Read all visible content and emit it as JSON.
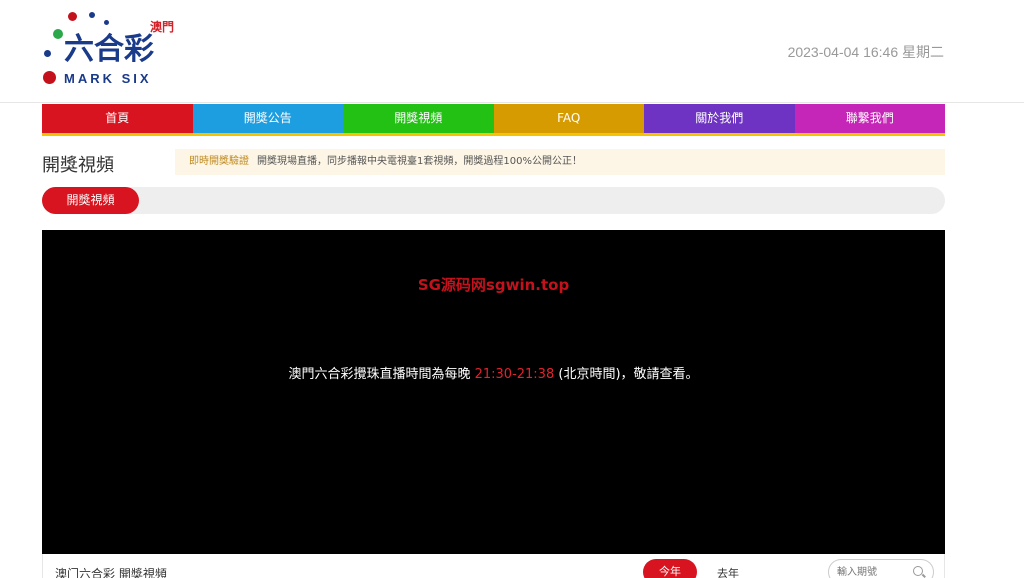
{
  "header": {
    "logo_macau": "澳門",
    "logo_zh": "六合彩",
    "logo_en": "MARK SIX",
    "datetime": "2023-04-04 16:46 星期二"
  },
  "nav": [
    {
      "label": "首頁",
      "color": "#d7141f"
    },
    {
      "label": "開獎公告",
      "color": "#1d9ee0"
    },
    {
      "label": "開獎視頻",
      "color": "#22c113"
    },
    {
      "label": "FAQ",
      "color": "#d69b00"
    },
    {
      "label": "關於我們",
      "color": "#6e33c2"
    },
    {
      "label": "聯繫我們",
      "color": "#c626b8"
    }
  ],
  "section": {
    "title": "開獎視頻",
    "notice_highlight": "即時開獎驗證",
    "notice_text": "開獎現場直播，同步播報中央電視臺1套視頻，開獎過程100%公開公正！"
  },
  "tabs": {
    "active": "開獎視頻"
  },
  "video": {
    "watermark": "SG源码网sgwin.top",
    "msg_prefix": "澳門六合彩攪珠直播時間為每晚 ",
    "msg_time": "21:30-21:38",
    "msg_suffix": " (北京時間)，敬請查看。"
  },
  "bottom": {
    "title": "澳门六合彩 開獎視頻",
    "year_this": "今年",
    "year_last": "去年",
    "search_placeholder": "輸入期號"
  }
}
